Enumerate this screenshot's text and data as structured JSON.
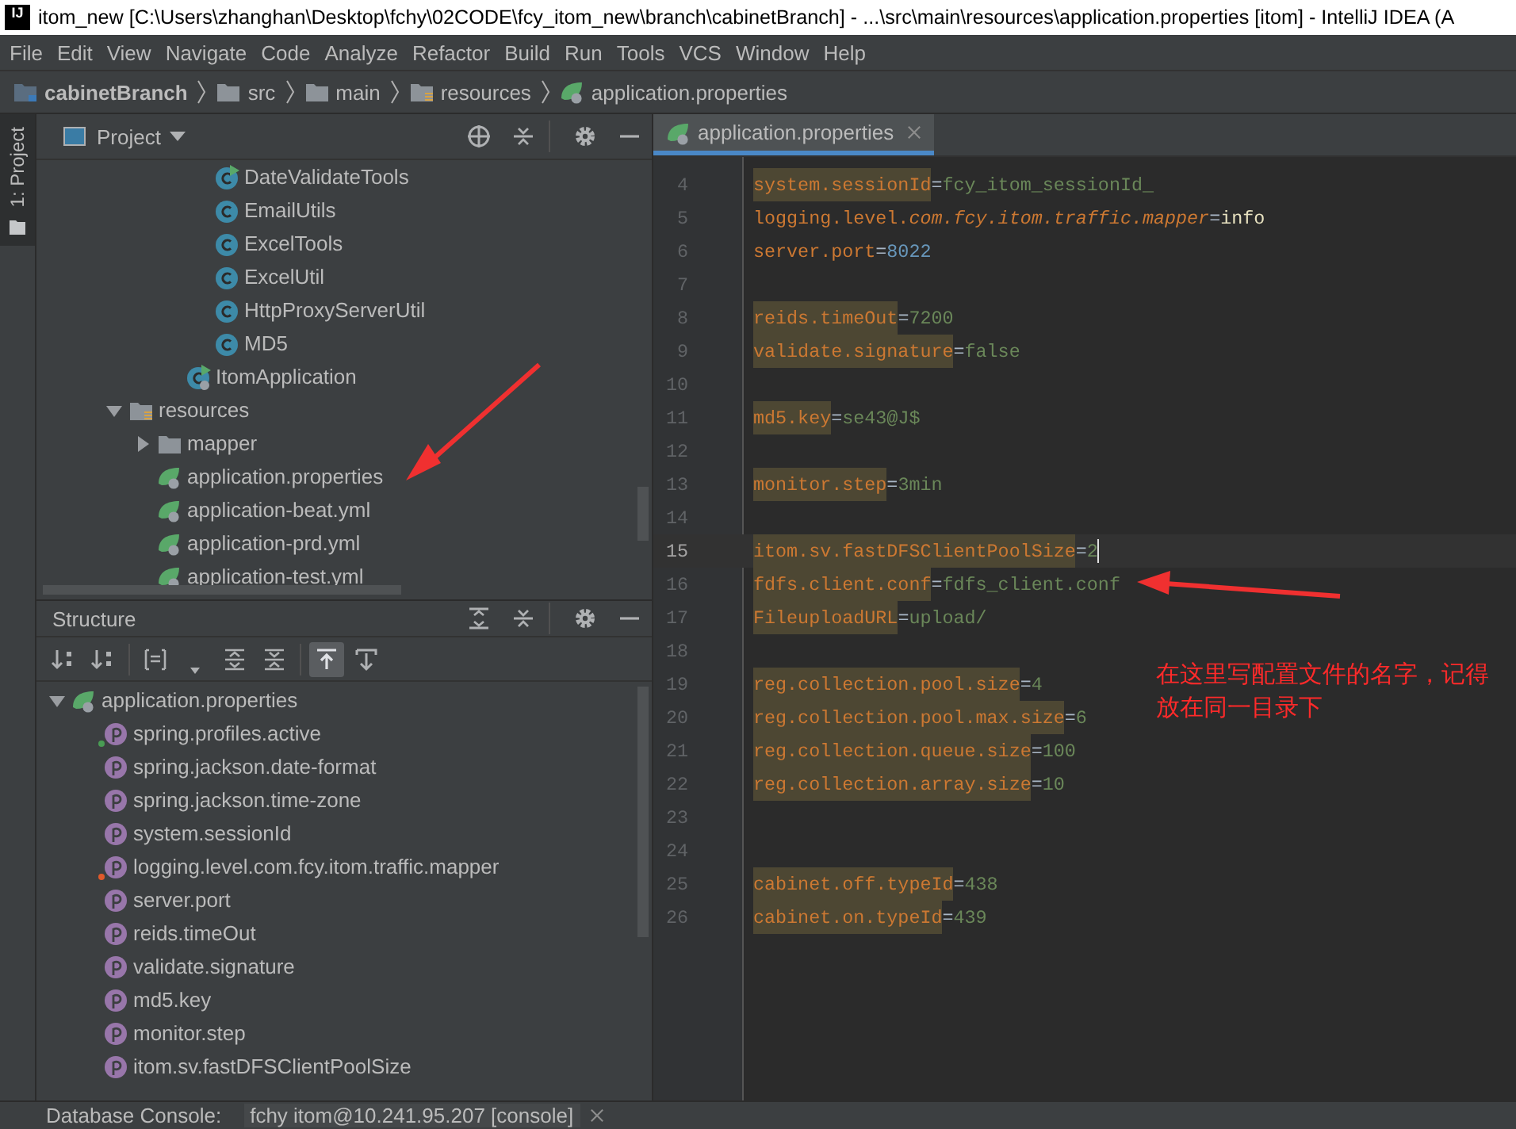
{
  "window": {
    "app_icon_text": "IJ",
    "title": "itom_new [C:\\Users\\zhanghan\\Desktop\\fchy\\02CODE\\fcy_itom_new\\branch\\cabinetBranch] - ...\\src\\main\\resources\\application.properties [itom] - IntelliJ IDEA (A"
  },
  "menu": [
    "File",
    "Edit",
    "View",
    "Navigate",
    "Code",
    "Analyze",
    "Refactor",
    "Build",
    "Run",
    "Tools",
    "VCS",
    "Window",
    "Help"
  ],
  "breadcrumb": [
    {
      "label": "cabinetBranch",
      "kind": "module"
    },
    {
      "label": "src",
      "kind": "folder"
    },
    {
      "label": "main",
      "kind": "folder"
    },
    {
      "label": "resources",
      "kind": "resources"
    },
    {
      "label": "application.properties",
      "kind": "config"
    }
  ],
  "side_tab": {
    "label": "1: Project",
    "selected": true
  },
  "project": {
    "title": "Project",
    "tree": [
      {
        "children": [
          {
            "children": [
              {
                "children": [
                  {
                    "label": "DateValidateTools",
                    "kind": "main-class"
                  },
                  {
                    "label": "EmailUtils",
                    "kind": "class"
                  },
                  {
                    "label": "ExcelTools",
                    "kind": "class"
                  },
                  {
                    "label": "ExcelUtil",
                    "kind": "class"
                  },
                  {
                    "label": "HttpProxyServerUtil",
                    "kind": "class"
                  },
                  {
                    "label": "MD5",
                    "kind": "class"
                  }
                ]
              },
              {
                "label": "ItomApplication",
                "kind": "app"
              }
            ]
          }
        ]
      },
      {
        "label": "resources",
        "kind": "resources",
        "expanded": true,
        "children": [
          {
            "label": "mapper",
            "kind": "folder",
            "expanded": false
          },
          {
            "label": "application.properties",
            "kind": "config"
          },
          {
            "label": "application-beat.yml",
            "kind": "config"
          },
          {
            "label": "application-prd.yml",
            "kind": "config"
          },
          {
            "label": "application-test.yml",
            "kind": "config"
          }
        ]
      }
    ]
  },
  "structure": {
    "title": "Structure",
    "toolbar": [
      {
        "kind": "sort-alpha",
        "selected": false
      },
      {
        "kind": "sort-type",
        "selected": false
      },
      {
        "kind": "fields",
        "selected": false
      },
      {
        "kind": "dropdown",
        "selected": false
      },
      {
        "kind": "expand",
        "selected": false
      },
      {
        "kind": "collapse",
        "selected": false
      },
      {
        "kind": "autoscroll-to",
        "selected": true
      },
      {
        "kind": "autoscroll-from",
        "selected": false
      }
    ],
    "tree": [
      {
        "label": "application.properties",
        "kind": "config",
        "expanded": true,
        "children": [
          {
            "label": "spring.profiles.active",
            "kind": "property",
            "color": "#499c54"
          },
          {
            "label": "spring.jackson.date-format",
            "kind": "property"
          },
          {
            "label": "spring.jackson.time-zone",
            "kind": "property"
          },
          {
            "label": "system.sessionId",
            "kind": "property"
          },
          {
            "label": "logging.level.com.fcy.itom.traffic.mapper",
            "kind": "property",
            "color": "#e0592a"
          },
          {
            "label": "server.port",
            "kind": "property"
          },
          {
            "label": "reids.timeOut",
            "kind": "property"
          },
          {
            "label": "validate.signature",
            "kind": "property"
          },
          {
            "label": "md5.key",
            "kind": "property"
          },
          {
            "label": "monitor.step",
            "kind": "property"
          },
          {
            "label": "itom.sv.fastDFSClientPoolSize",
            "kind": "property"
          }
        ]
      }
    ]
  },
  "editor": {
    "tab": {
      "label": "application.properties",
      "selected": true
    },
    "lines": [
      {
        "number": "4",
        "kind": "property",
        "key": "system.sessionId",
        "separator": "=",
        "value": {
          "text": "fcy_itom_sessionId_",
          "kind": "string"
        },
        "highlighted": true,
        "current": false
      },
      {
        "number": "5",
        "kind": "property",
        "key": "logging.level.*com.fcy.itom.traffic.mapper*",
        "separator": "=",
        "value": {
          "text": "info",
          "kind": "keyword"
        },
        "highlighted": false,
        "current": false
      },
      {
        "number": "6",
        "kind": "property",
        "key": "server.port",
        "separator": "=",
        "value": {
          "text": "8022",
          "kind": "number"
        },
        "highlighted": false,
        "current": false
      },
      {
        "number": "7",
        "kind": "blank",
        "current": false
      },
      {
        "number": "8",
        "kind": "property",
        "key": "reids.timeOut",
        "separator": "=",
        "value": {
          "text": "7200",
          "kind": "string"
        },
        "highlighted": true,
        "current": false
      },
      {
        "number": "9",
        "kind": "property",
        "key": "validate.signature",
        "separator": "=",
        "value": {
          "text": "false",
          "kind": "string"
        },
        "highlighted": true,
        "current": false
      },
      {
        "number": "10",
        "kind": "blank",
        "current": false
      },
      {
        "number": "11",
        "kind": "property",
        "key": "md5.key",
        "separator": "=",
        "value": {
          "text": "se43@J$",
          "kind": "string"
        },
        "highlighted": true,
        "current": false
      },
      {
        "number": "12",
        "kind": "blank",
        "current": false
      },
      {
        "number": "13",
        "kind": "property",
        "key": "monitor.step",
        "separator": "=",
        "value": {
          "text": "3min",
          "kind": "string"
        },
        "highlighted": true,
        "current": false
      },
      {
        "number": "14",
        "kind": "blank",
        "current": false
      },
      {
        "number": "15",
        "kind": "property",
        "key": "itom.sv.fastDFSClientPoolSize",
        "separator": "=",
        "value": {
          "text": "2",
          "kind": "string"
        },
        "highlighted": true,
        "current": true
      },
      {
        "number": "16",
        "kind": "property",
        "key": "fdfs.client.conf",
        "separator": "=",
        "value": {
          "text": "fdfs_client.conf",
          "kind": "string"
        },
        "highlighted": true,
        "current": false
      },
      {
        "number": "17",
        "kind": "property",
        "key": "FileuploadURL",
        "separator": "=",
        "value": {
          "text": "upload/",
          "kind": "string"
        },
        "highlighted": true,
        "current": false
      },
      {
        "number": "18",
        "kind": "blank",
        "current": false
      },
      {
        "number": "19",
        "kind": "property",
        "key": "reg.collection.pool.size",
        "separator": "=",
        "value": {
          "text": "4",
          "kind": "string"
        },
        "highlighted": true,
        "current": false
      },
      {
        "number": "20",
        "kind": "property",
        "key": "reg.collection.pool.max.size",
        "separator": "=",
        "value": {
          "text": "6",
          "kind": "string"
        },
        "highlighted": true,
        "current": false
      },
      {
        "number": "21",
        "kind": "property",
        "key": "reg.collection.queue.size",
        "separator": "=",
        "value": {
          "text": "100",
          "kind": "string"
        },
        "highlighted": true,
        "current": false
      },
      {
        "number": "22",
        "kind": "property",
        "key": "reg.collection.array.size",
        "separator": "=",
        "value": {
          "text": "10",
          "kind": "string"
        },
        "highlighted": true,
        "current": false
      },
      {
        "number": "23",
        "kind": "blank",
        "current": false
      },
      {
        "number": "24",
        "kind": "blank",
        "current": false
      },
      {
        "number": "25",
        "kind": "property",
        "key": "cabinet.off.typeId",
        "separator": "=",
        "value": {
          "text": "438",
          "kind": "string"
        },
        "highlighted": true,
        "current": false
      },
      {
        "number": "26",
        "kind": "property",
        "key": "cabinet.on.typeId",
        "separator": "=",
        "value": {
          "text": "439",
          "kind": "string"
        },
        "highlighted": true,
        "current": false
      }
    ],
    "annotation": "在这里写配置文件的名字，记得放在同一目录下"
  },
  "bottom_bar": {
    "label": "Database Console:",
    "tab": "fchy itom@10.241.95.207 [console]"
  }
}
